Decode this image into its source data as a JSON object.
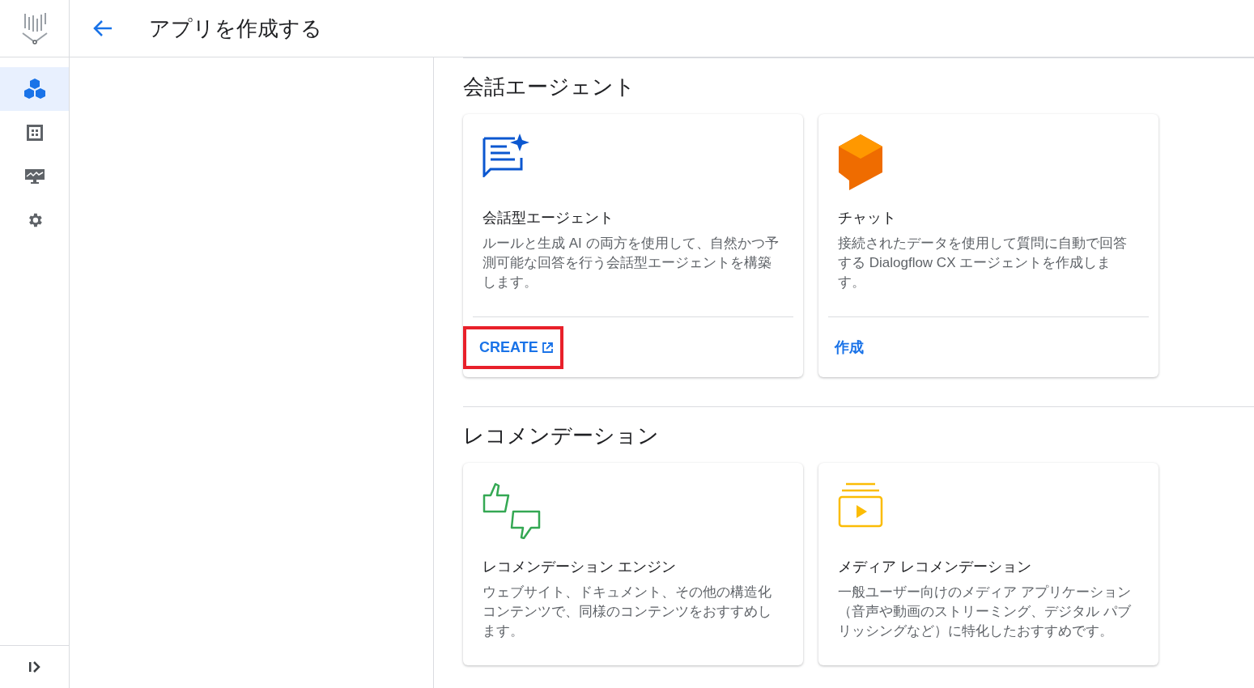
{
  "header": {
    "title": "アプリを作成する"
  },
  "sidebar": {
    "items": [
      {
        "kind": "cubes",
        "selected": true
      },
      {
        "kind": "grid",
        "selected": false
      },
      {
        "kind": "monitor",
        "selected": false
      },
      {
        "kind": "settings",
        "selected": false
      }
    ]
  },
  "sections": [
    {
      "title": "会話エージェント",
      "cards": [
        {
          "kind": "agent",
          "title": "会話型エージェント",
          "description": "ルールと生成 AI の両方を使用して、自然かつ予測可能な回答を行う会話型エージェントを構築します。",
          "action": {
            "label": "CREATE",
            "external": true,
            "highlighted": true
          }
        },
        {
          "kind": "cube",
          "title": "チャット",
          "description": "接続されたデータを使用して質問に自動で回答する Dialogflow CX エージェントを作成します。",
          "action": {
            "label": "作成",
            "external": false,
            "highlighted": false
          }
        }
      ]
    },
    {
      "title": "レコメンデーション",
      "cards": [
        {
          "kind": "thumbs",
          "title": "レコメンデーション エンジン",
          "description": "ウェブサイト、ドキュメント、その他の構造化コンテンツで、同様のコンテンツをおすすめします。"
        },
        {
          "kind": "media",
          "title": "メディア レコメンデーション",
          "description": "一般ユーザー向けのメディア アプリケーション（音声や動画のストリーミング、デジタル パブリッシングなど）に特化したおすすめです。"
        }
      ]
    }
  ]
}
